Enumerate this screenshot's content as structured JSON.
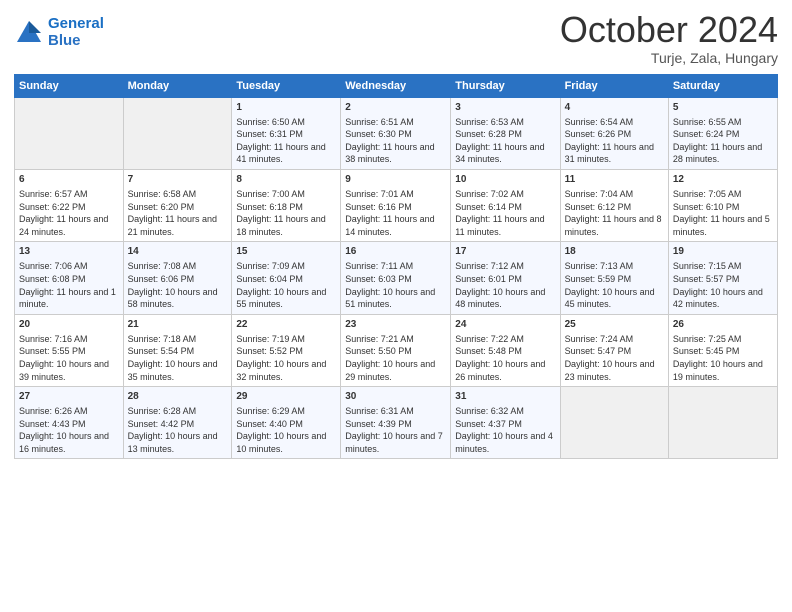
{
  "header": {
    "logo_line1": "General",
    "logo_line2": "Blue",
    "main_title": "October 2024",
    "subtitle": "Turje, Zala, Hungary"
  },
  "days_of_week": [
    "Sunday",
    "Monday",
    "Tuesday",
    "Wednesday",
    "Thursday",
    "Friday",
    "Saturday"
  ],
  "weeks": [
    [
      {
        "day": "",
        "info": ""
      },
      {
        "day": "",
        "info": ""
      },
      {
        "day": "1",
        "info": "Sunrise: 6:50 AM\nSunset: 6:31 PM\nDaylight: 11 hours and 41 minutes."
      },
      {
        "day": "2",
        "info": "Sunrise: 6:51 AM\nSunset: 6:30 PM\nDaylight: 11 hours and 38 minutes."
      },
      {
        "day": "3",
        "info": "Sunrise: 6:53 AM\nSunset: 6:28 PM\nDaylight: 11 hours and 34 minutes."
      },
      {
        "day": "4",
        "info": "Sunrise: 6:54 AM\nSunset: 6:26 PM\nDaylight: 11 hours and 31 minutes."
      },
      {
        "day": "5",
        "info": "Sunrise: 6:55 AM\nSunset: 6:24 PM\nDaylight: 11 hours and 28 minutes."
      }
    ],
    [
      {
        "day": "6",
        "info": "Sunrise: 6:57 AM\nSunset: 6:22 PM\nDaylight: 11 hours and 24 minutes."
      },
      {
        "day": "7",
        "info": "Sunrise: 6:58 AM\nSunset: 6:20 PM\nDaylight: 11 hours and 21 minutes."
      },
      {
        "day": "8",
        "info": "Sunrise: 7:00 AM\nSunset: 6:18 PM\nDaylight: 11 hours and 18 minutes."
      },
      {
        "day": "9",
        "info": "Sunrise: 7:01 AM\nSunset: 6:16 PM\nDaylight: 11 hours and 14 minutes."
      },
      {
        "day": "10",
        "info": "Sunrise: 7:02 AM\nSunset: 6:14 PM\nDaylight: 11 hours and 11 minutes."
      },
      {
        "day": "11",
        "info": "Sunrise: 7:04 AM\nSunset: 6:12 PM\nDaylight: 11 hours and 8 minutes."
      },
      {
        "day": "12",
        "info": "Sunrise: 7:05 AM\nSunset: 6:10 PM\nDaylight: 11 hours and 5 minutes."
      }
    ],
    [
      {
        "day": "13",
        "info": "Sunrise: 7:06 AM\nSunset: 6:08 PM\nDaylight: 11 hours and 1 minute."
      },
      {
        "day": "14",
        "info": "Sunrise: 7:08 AM\nSunset: 6:06 PM\nDaylight: 10 hours and 58 minutes."
      },
      {
        "day": "15",
        "info": "Sunrise: 7:09 AM\nSunset: 6:04 PM\nDaylight: 10 hours and 55 minutes."
      },
      {
        "day": "16",
        "info": "Sunrise: 7:11 AM\nSunset: 6:03 PM\nDaylight: 10 hours and 51 minutes."
      },
      {
        "day": "17",
        "info": "Sunrise: 7:12 AM\nSunset: 6:01 PM\nDaylight: 10 hours and 48 minutes."
      },
      {
        "day": "18",
        "info": "Sunrise: 7:13 AM\nSunset: 5:59 PM\nDaylight: 10 hours and 45 minutes."
      },
      {
        "day": "19",
        "info": "Sunrise: 7:15 AM\nSunset: 5:57 PM\nDaylight: 10 hours and 42 minutes."
      }
    ],
    [
      {
        "day": "20",
        "info": "Sunrise: 7:16 AM\nSunset: 5:55 PM\nDaylight: 10 hours and 39 minutes."
      },
      {
        "day": "21",
        "info": "Sunrise: 7:18 AM\nSunset: 5:54 PM\nDaylight: 10 hours and 35 minutes."
      },
      {
        "day": "22",
        "info": "Sunrise: 7:19 AM\nSunset: 5:52 PM\nDaylight: 10 hours and 32 minutes."
      },
      {
        "day": "23",
        "info": "Sunrise: 7:21 AM\nSunset: 5:50 PM\nDaylight: 10 hours and 29 minutes."
      },
      {
        "day": "24",
        "info": "Sunrise: 7:22 AM\nSunset: 5:48 PM\nDaylight: 10 hours and 26 minutes."
      },
      {
        "day": "25",
        "info": "Sunrise: 7:24 AM\nSunset: 5:47 PM\nDaylight: 10 hours and 23 minutes."
      },
      {
        "day": "26",
        "info": "Sunrise: 7:25 AM\nSunset: 5:45 PM\nDaylight: 10 hours and 19 minutes."
      }
    ],
    [
      {
        "day": "27",
        "info": "Sunrise: 6:26 AM\nSunset: 4:43 PM\nDaylight: 10 hours and 16 minutes."
      },
      {
        "day": "28",
        "info": "Sunrise: 6:28 AM\nSunset: 4:42 PM\nDaylight: 10 hours and 13 minutes."
      },
      {
        "day": "29",
        "info": "Sunrise: 6:29 AM\nSunset: 4:40 PM\nDaylight: 10 hours and 10 minutes."
      },
      {
        "day": "30",
        "info": "Sunrise: 6:31 AM\nSunset: 4:39 PM\nDaylight: 10 hours and 7 minutes."
      },
      {
        "day": "31",
        "info": "Sunrise: 6:32 AM\nSunset: 4:37 PM\nDaylight: 10 hours and 4 minutes."
      },
      {
        "day": "",
        "info": ""
      },
      {
        "day": "",
        "info": ""
      }
    ]
  ]
}
